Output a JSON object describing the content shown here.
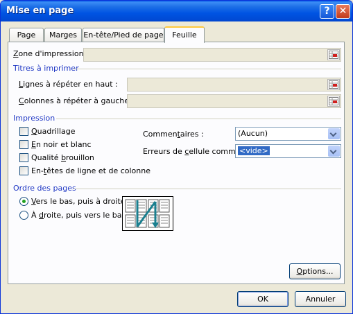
{
  "window": {
    "title": "Mise en page",
    "help_icon": "question-icon",
    "close_icon": "close-x-icon"
  },
  "tabs": [
    {
      "label": "Page"
    },
    {
      "label": "Marges"
    },
    {
      "label": "En-tête/Pied de page"
    },
    {
      "label": "Feuille"
    }
  ],
  "active_tab": "Feuille",
  "print_area": {
    "label_pre": "Z",
    "label_rest": "one d'impression :",
    "value": ""
  },
  "print_titles": {
    "heading": "Titres à imprimer",
    "rows_label_pre": "L",
    "rows_label_rest": "ignes à répéter en haut :",
    "rows_value": "",
    "cols_label_pre": "C",
    "cols_label_rest": "olonnes à répéter à gauche :",
    "cols_value": ""
  },
  "print": {
    "heading": "Impression",
    "gridlines_pre": "Q",
    "gridlines_rest": "uadrillage",
    "bw_pre": "E",
    "bw_rest": "n noir et blanc",
    "draft_pre": "Qualité ",
    "draft_u": "b",
    "draft_rest": "rouillon",
    "headings_pre": "En-",
    "headings_u": "t",
    "headings_rest": "êtes de ligne et de colonne",
    "checkboxes": {
      "gridlines": false,
      "black_white": false,
      "draft": false,
      "row_col_headings": false
    },
    "comments_label_pre": "Commen",
    "comments_label_u": "t",
    "comments_label_rest": "aires :",
    "comments_value": "(Aucun)",
    "errors_label_pre": "Erreurs de ",
    "errors_label_u": "c",
    "errors_label_rest": "ellule comme :",
    "errors_value": "<vide>"
  },
  "page_order": {
    "heading": "Ordre des pages",
    "down_pre": "V",
    "down_rest": "ers le bas, puis à droite",
    "over_pre": "À ",
    "over_u": "d",
    "over_rest": "roite, puis vers le bas",
    "selected": "down"
  },
  "buttons": {
    "options_pre": "O",
    "options_rest": "ptions...",
    "ok": "OK",
    "cancel": "Annuler"
  }
}
